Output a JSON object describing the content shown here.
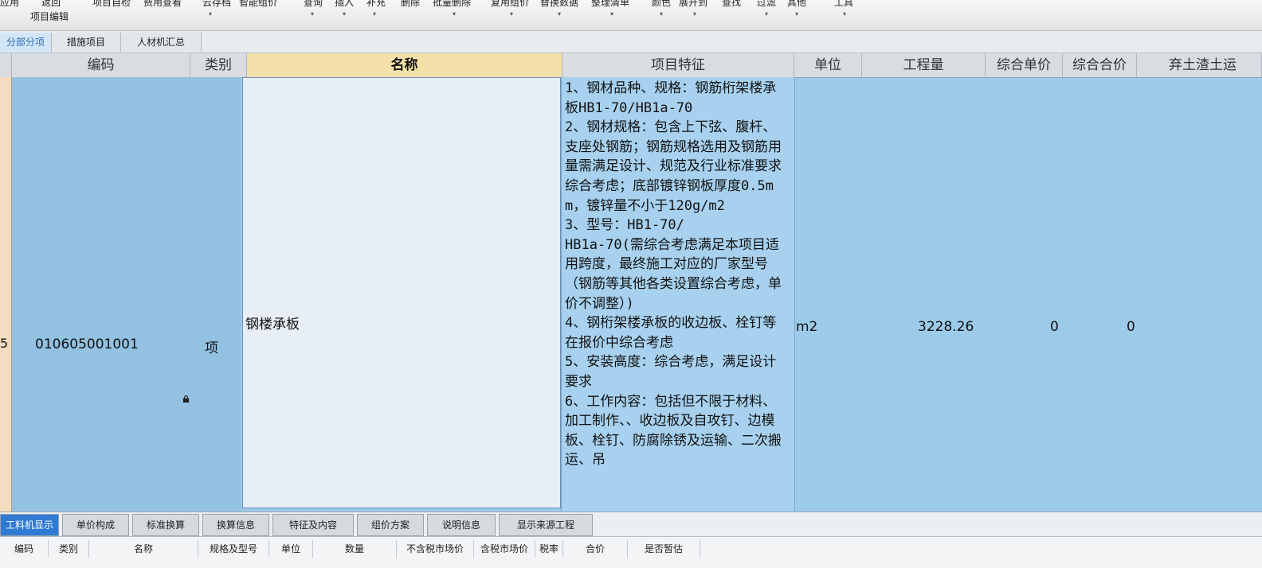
{
  "toolbar": {
    "items": [
      "应用",
      "返回",
      "项目自检",
      "费用查看",
      "云存档",
      "智能组价",
      "查询",
      "插入",
      "补充",
      "删除",
      "批量删除",
      "复用组价",
      "替换数据",
      "整理清单",
      "颜色",
      "展开到",
      "查找",
      "过滤",
      "其他",
      "工具"
    ],
    "sub_label": "项目编辑"
  },
  "top_tabs": [
    "分部分项",
    "措施项目",
    "人材机汇总"
  ],
  "grid": {
    "headers": [
      "编码",
      "类别",
      "名称",
      "项目特征",
      "单位",
      "工程量",
      "综合单价",
      "综合合价",
      "弃土渣土运"
    ],
    "row": {
      "row_number": "5",
      "code": "010605001001",
      "category": "项",
      "name": "钢楼承板",
      "features": "1、钢材品种、规格：钢筋桁架楼承板HB1-70/HB1a-70\n2、钢材规格：包含上下弦、腹杆、支座处钢筋；钢筋规格选用及钢筋用量需满足设计、规范及行业标准要求综合考虑；底部镀锌钢板厚度0.5mm，镀锌量不小于120g/m2\n3、型号：HB1-70/\nHB1a-70(需综合考虑满足本项目适用跨度，最终施工对应的厂家型号（钢筋等其他各类设置综合考虑，单价不调整）)\n4、钢桁架楼承板的收边板、栓钉等在报价中综合考虑\n5、安装高度：综合考虑，满足设计要求\n6、工作内容：包括但不限于材料、加工制作、、收边板及自攻钉、边模板、栓钉、防腐除锈及运输、二次搬运、吊",
      "unit": "m2",
      "quantity": "3228.26",
      "unit_price": "0",
      "total_price": "0"
    }
  },
  "bottom_tabs": [
    "工料机显示",
    "单价构成",
    "标准换算",
    "换算信息",
    "特征及内容",
    "组价方案",
    "说明信息",
    "显示来源工程"
  ],
  "bottom_headers": [
    "编码",
    "类别",
    "名称",
    "规格及型号",
    "单位",
    "数量",
    "不含税市场价",
    "含税市场价",
    "税率",
    "合价",
    "是否暂估"
  ],
  "colors": {
    "row_bg": "#9ccbe9",
    "active_tab": "#2f7bd3",
    "selected_header": "#f3e0a8"
  }
}
